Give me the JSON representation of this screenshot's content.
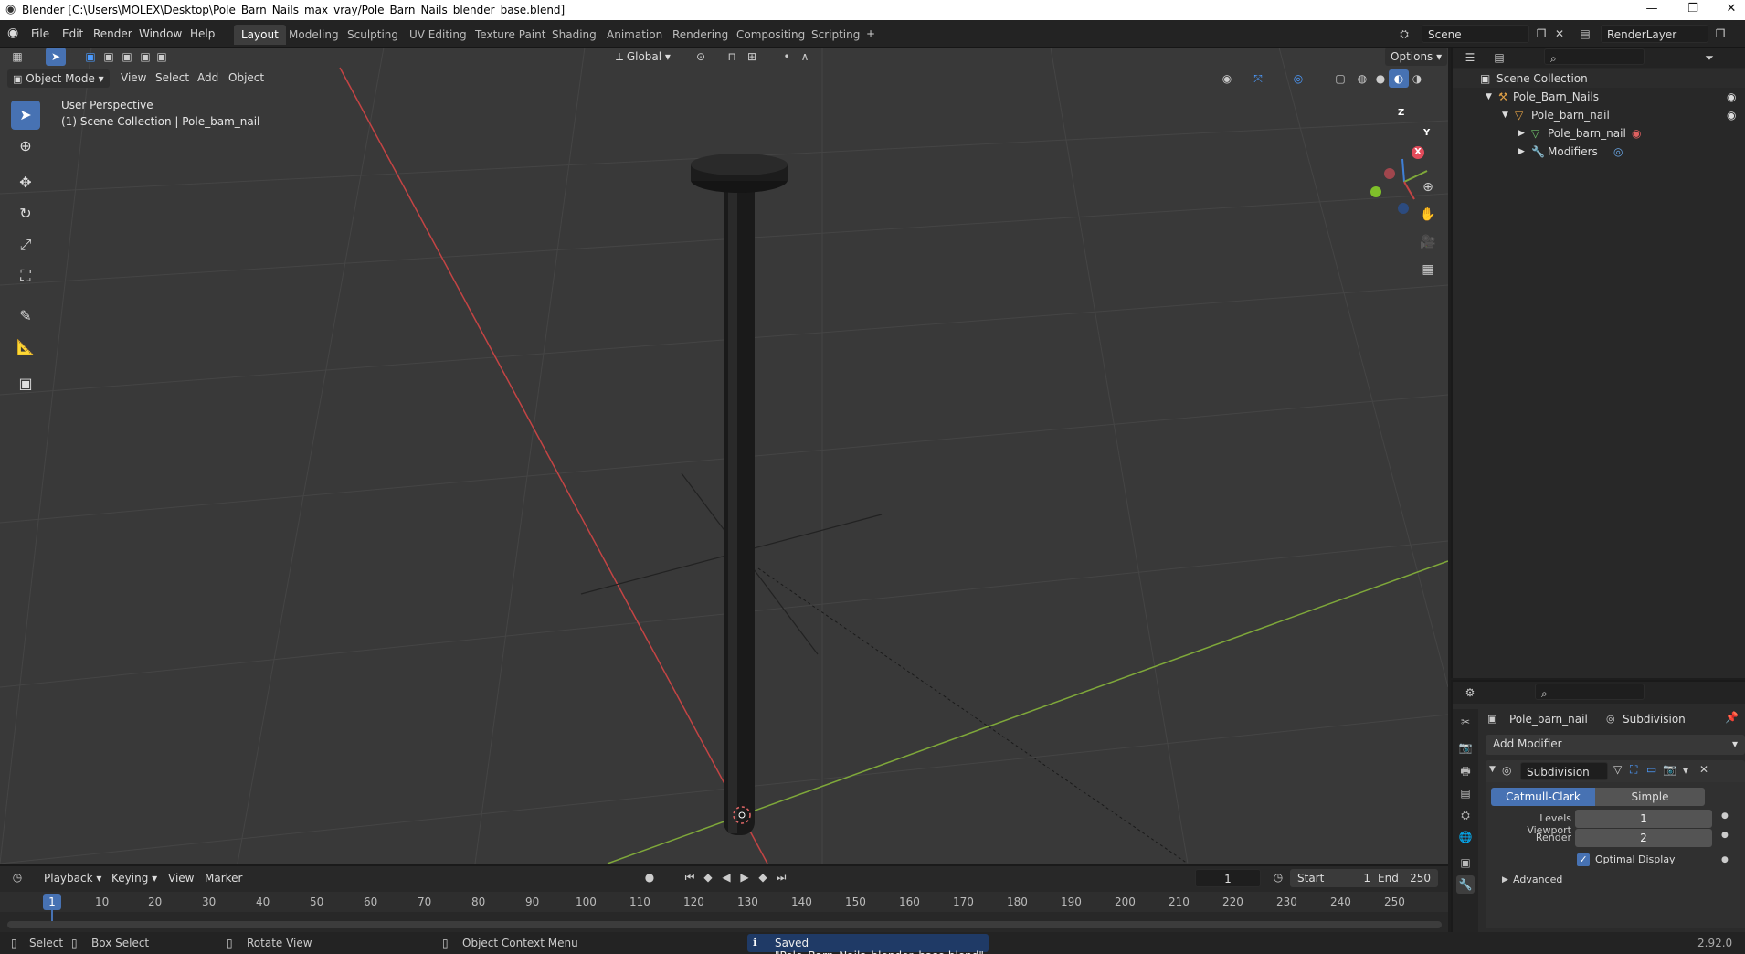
{
  "window": {
    "title": "Blender [C:\\Users\\MOLEX\\Desktop\\Pole_Barn_Nails_max_vray/Pole_Barn_Nails_blender_base.blend]",
    "minimize": "—",
    "restore": "❐",
    "close": "✕"
  },
  "menu": [
    "File",
    "Edit",
    "Render",
    "Window",
    "Help"
  ],
  "workspaces": [
    "Layout",
    "Modeling",
    "Sculpting",
    "UV Editing",
    "Texture Paint",
    "Shading",
    "Animation",
    "Rendering",
    "Compositing",
    "Scripting"
  ],
  "active_workspace": "Layout",
  "scene": {
    "name": "Scene",
    "view_layer": "RenderLayer"
  },
  "viewport": {
    "mode": "Object Mode",
    "menus": [
      "View",
      "Select",
      "Add",
      "Object"
    ],
    "transform_orientation": "Global",
    "options": "Options",
    "overlay_title": "User Perspective",
    "overlay_sub": "(1) Scene Collection | Pole_bam_nail",
    "gizmo": {
      "x": "X",
      "y": "Y",
      "z": "Z"
    }
  },
  "outliner": {
    "root": "Scene Collection",
    "items": [
      {
        "label": "Pole_Barn_Nails",
        "icon": "collection-icon"
      },
      {
        "label": "Pole_barn_nail",
        "icon": "object-icon"
      },
      {
        "label": "Pole_barn_nail",
        "icon": "mesh-icon"
      },
      {
        "label": "Modifiers",
        "icon": "wrench-icon"
      }
    ]
  },
  "properties": {
    "object": "Pole_barn_nail",
    "modifier_ctx": "Subdivision",
    "add_modifier": "Add Modifier",
    "modifier_name": "Subdivision",
    "algo_a": "Catmull-Clark",
    "algo_b": "Simple",
    "levels_viewport_label": "Levels Viewport",
    "levels_viewport": "1",
    "render_label": "Render",
    "render": "2",
    "optimal_display": "Optimal Display",
    "optimal_display_checked": true,
    "advanced": "Advanced"
  },
  "timeline": {
    "menus": [
      "Playback",
      "Keying",
      "View",
      "Marker"
    ],
    "current_frame": "1",
    "start_label": "Start",
    "start": "1",
    "end_label": "End",
    "end": "250",
    "ticks": [
      "10",
      "20",
      "30",
      "40",
      "50",
      "60",
      "70",
      "80",
      "90",
      "100",
      "110",
      "120",
      "130",
      "140",
      "150",
      "160",
      "170",
      "180",
      "190",
      "200",
      "210",
      "220",
      "230",
      "240",
      "250"
    ],
    "cursor": "1"
  },
  "status": {
    "select": "Select",
    "box_select": "Box Select",
    "rotate_view": "Rotate View",
    "context_menu": "Object Context Menu",
    "message": "Saved \"Pole_Barn_Nails_blender_base.blend\"",
    "version": "2.92.0"
  },
  "colors": {
    "accent": "#4772b3",
    "x_axis": "#c44444",
    "y_axis": "#7fa83a",
    "z_axis": "#3f7fd6"
  }
}
